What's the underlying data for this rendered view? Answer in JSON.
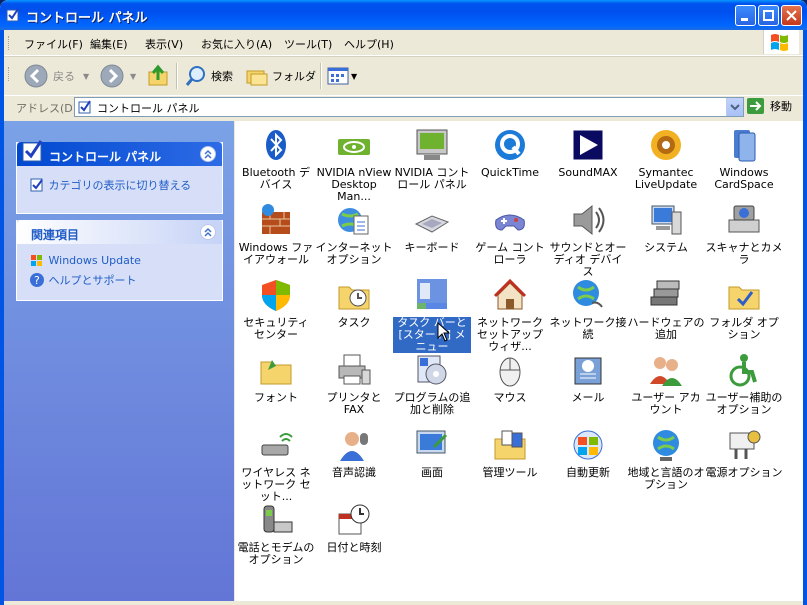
{
  "window": {
    "title": "コントロール パネル"
  },
  "menu": [
    "ファイル(F)",
    "編集(E)",
    "表示(V)",
    "お気に入り(A)",
    "ツール(T)",
    "ヘルプ(H)"
  ],
  "toolbar": {
    "back": "戻る",
    "search": "検索",
    "folders": "フォルダ"
  },
  "address": {
    "label": "アドレス(D)",
    "value": "コントロール パネル",
    "go": "移動"
  },
  "sidebar": {
    "panel1": {
      "title": "コントロール パネル",
      "link": "カテゴリの表示に切り替える"
    },
    "panel2": {
      "title": "関連項目",
      "links": [
        "Windows Update",
        "ヘルプとサポート"
      ]
    }
  },
  "items": [
    [
      "Bluetooth デバイス",
      "NVIDIA nView Desktop Man...",
      "NVIDIA コントロール パネル",
      "QuickTime",
      "SoundMAX",
      "Symantec LiveUpdate",
      "Windows CardSpace"
    ],
    [
      "Windows ファイアウォール",
      "インターネット オプション",
      "キーボード",
      "ゲーム コントローラ",
      "サウンドとオーディオ デバイス",
      "システム",
      "スキャナとカメラ"
    ],
    [
      "セキュリティ センター",
      "タスク",
      "タスク バーと [スタート] メニュー",
      "ネットワーク セットアップ ウィザ...",
      "ネットワーク接続",
      "ハードウェアの追加",
      "フォルダ オプション"
    ],
    [
      "フォント",
      "プリンタと FAX",
      "プログラムの追加と削除",
      "マウス",
      "メール",
      "ユーザー アカウント",
      "ユーザー補助のオプション"
    ],
    [
      "ワイヤレス ネットワーク セット...",
      "音声認識",
      "画面",
      "管理ツール",
      "自動更新",
      "地域と言語のオプション",
      "電源オプション"
    ],
    [
      "電話とモデムのオプション",
      "日付と時刻"
    ]
  ]
}
